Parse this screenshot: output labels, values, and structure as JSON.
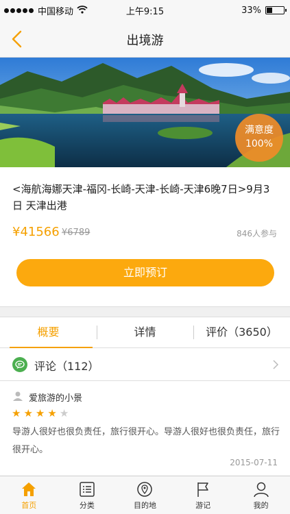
{
  "status_bar": {
    "carrier": "中国移动",
    "time": "上午9:15",
    "battery": "33%",
    "battery_level": 0.33
  },
  "nav": {
    "title": "出境游"
  },
  "hero": {
    "satisfaction_label": "满意度",
    "satisfaction_value": "100%"
  },
  "trip": {
    "title": "<海航海娜天津-福冈-长崎-天津-长崎-天津6晚7日>9月3日 天津出港",
    "price": "¥41566",
    "original_price": "¥6789",
    "participants": "846人参与",
    "book_label": "立即预订"
  },
  "tabs": [
    {
      "label": "概要"
    },
    {
      "label": "详情"
    },
    {
      "label": "评价（3650）"
    }
  ],
  "comments": {
    "header": "评论（112）",
    "review": {
      "user": "爱旅游的小景",
      "rating": 4,
      "max_rating": 5,
      "text": "导游人很好也很负责任，旅行很开心。导游人很好也很负责任，旅行很开心。",
      "date": "2015-07-11"
    }
  },
  "tabbar": [
    {
      "label": "首页",
      "icon": "home-icon",
      "active": true
    },
    {
      "label": "分类",
      "icon": "list-icon",
      "active": false
    },
    {
      "label": "目的地",
      "icon": "location-icon",
      "active": false
    },
    {
      "label": "游记",
      "icon": "flag-icon",
      "active": false
    },
    {
      "label": "我的",
      "icon": "user-icon",
      "active": false
    }
  ],
  "colors": {
    "accent": "#f5a000",
    "button": "#fca90e",
    "badge": "#f08c28",
    "chat": "#4caf50"
  }
}
